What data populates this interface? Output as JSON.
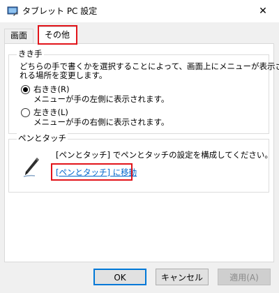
{
  "window": {
    "title": "タブレット PC 設定",
    "close_label": "✕"
  },
  "tabs": [
    {
      "label": "画面",
      "active": false
    },
    {
      "label": "その他",
      "active": true
    }
  ],
  "handedness": {
    "legend": "きき手",
    "description_line1": "どちらの手で書くかを選択することによって、画面上にメニューが表示さ",
    "description_line2": "れる場所を変更します。",
    "options": [
      {
        "label": "右きき(R)",
        "detail": "メニューが手の左側に表示されます。",
        "checked": true
      },
      {
        "label": "左きき(L)",
        "detail": "メニューが手の右側に表示されます。",
        "checked": false
      }
    ]
  },
  "pen_touch": {
    "legend": "ペンとタッチ",
    "description": "[ペンとタッチ] でペンとタッチの設定を構成してください。",
    "link_label": "[ペンとタッチ] に移動",
    "icon": "pen-icon"
  },
  "buttons": {
    "ok": "OK",
    "cancel": "キャンセル",
    "apply": "適用(A)"
  },
  "colors": {
    "highlight": "#e2141a",
    "link": "#0066cc",
    "ok_border": "#0078d7"
  }
}
